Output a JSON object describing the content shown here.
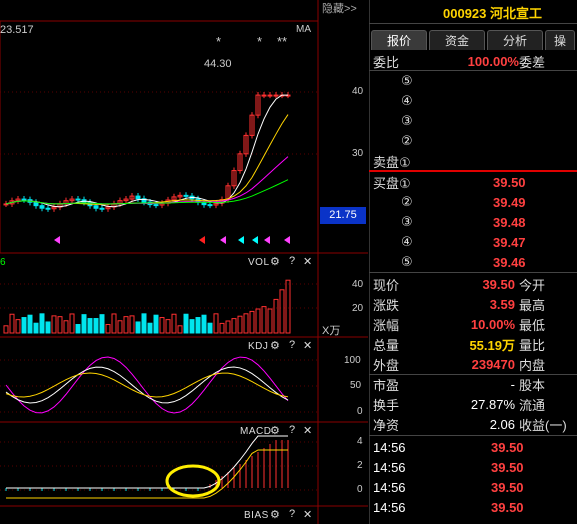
{
  "chart": {
    "ma_value_label": "23.517",
    "ma_label": "MA",
    "hide_label": "隐藏>>",
    "peak_label": "44.30",
    "price_ticks": [
      "40",
      "30"
    ],
    "current_price_tag": "21.75",
    "vol_left_value": "6",
    "vol_label": "VOL",
    "vol_ticks": [
      "40",
      "20"
    ],
    "vol_unit": "X万",
    "kdj_label": "KDJ",
    "kdj_ticks": [
      "100",
      "50",
      "0"
    ],
    "macd_label": "MACD",
    "macd_ticks": [
      "4",
      "2",
      "0"
    ],
    "bias_label": "BIAS",
    "star_marks": [
      "*",
      "*",
      "**"
    ],
    "colors": {
      "up": "#ff3030",
      "down": "#00e5ee",
      "ma5": "#ffffff",
      "ma10": "#ffd400",
      "ma20": "#ff00ff",
      "ma60": "#00ff00"
    }
  },
  "panel": {
    "code": "000923",
    "name": "河北宣工",
    "tabs": [
      "报价",
      "资金",
      "分析",
      "操"
    ],
    "weibi_label": "委比",
    "weibi_value": "100.00%",
    "weicha_label": "委差",
    "sell_levels": [
      "⑤",
      "④",
      "③",
      "②",
      "卖盘①"
    ],
    "buy_levels": [
      {
        "label": "买盘①",
        "price": "39.50"
      },
      {
        "label": "②",
        "price": "39.49"
      },
      {
        "label": "③",
        "price": "39.48"
      },
      {
        "label": "④",
        "price": "39.47"
      },
      {
        "label": "⑤",
        "price": "39.46"
      }
    ],
    "quote_rows": [
      {
        "k1": "现价",
        "v1": "39.50",
        "k2": "今开",
        "v2": ""
      },
      {
        "k1": "涨跌",
        "v1": "3.59",
        "k2": "最高",
        "v2": ""
      },
      {
        "k1": "涨幅",
        "v1": "10.00%",
        "k2": "最低",
        "v2": ""
      },
      {
        "k1": "总量",
        "v1": "55.19万",
        "k2": "量比",
        "v2": ""
      },
      {
        "k1": "外盘",
        "v1": "239470",
        "k2": "内盘",
        "v2": ""
      }
    ],
    "fund_rows": [
      {
        "k1": "市盈",
        "v1": "-",
        "k2": "股本"
      },
      {
        "k1": "换手",
        "v1": "27.87%",
        "k2": "流通"
      },
      {
        "k1": "净资",
        "v1": "2.06",
        "k2": "收益(一)"
      }
    ],
    "ticks": [
      {
        "time": "14:56",
        "price": "39.50"
      },
      {
        "time": "14:56",
        "price": "39.50"
      },
      {
        "time": "14:56",
        "price": "39.50"
      },
      {
        "time": "14:56",
        "price": "39.50"
      }
    ]
  }
}
